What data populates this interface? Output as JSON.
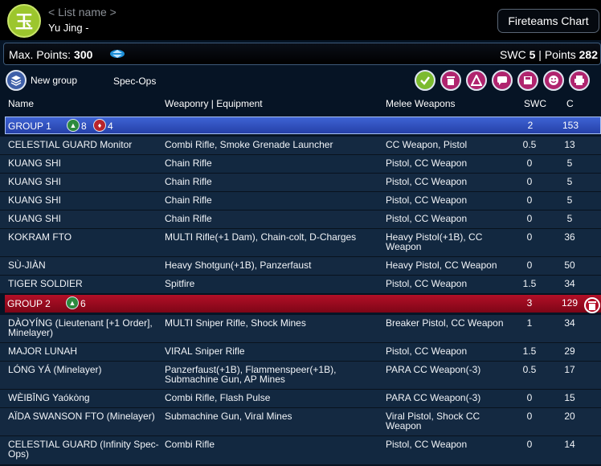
{
  "header": {
    "faction_glyph": "玉",
    "list_name": "< List name >",
    "sectorial": "Yu Jing -",
    "fireteams_button": "Fireteams Chart"
  },
  "points": {
    "max_label": "Max. Points:",
    "max_value": "300",
    "swc_label": "SWC",
    "swc_value": "5",
    "separator": "|",
    "points_label": "Points",
    "points_value": "282"
  },
  "toolbar": {
    "new_group": "New group",
    "specops": "Spec-Ops",
    "icons": [
      "validate-icon",
      "trash-icon",
      "army-logo-icon",
      "chat-icon",
      "save-icon",
      "smiley-icon",
      "print-icon"
    ]
  },
  "columns": {
    "name": "Name",
    "weapons": "Weaponry | Equipment",
    "melee": "Melee Weapons",
    "swc": "SWC",
    "c": "C"
  },
  "groups": [
    {
      "label": "GROUP 1",
      "regular": "8",
      "irregular": "4",
      "swc": "2",
      "c": "153"
    },
    {
      "label": "GROUP 2",
      "regular": "6",
      "swc": "3",
      "c": "129"
    }
  ],
  "group1_units": [
    {
      "name": "CELESTIAL GUARD Monitor",
      "weapons": "Combi Rifle, Smoke Grenade Launcher",
      "melee": "CC Weapon, Pistol",
      "swc": "0.5",
      "c": "13"
    },
    {
      "name": "KUANG SHI",
      "weapons": "Chain Rifle",
      "melee": "Pistol, CC Weapon",
      "swc": "0",
      "c": "5"
    },
    {
      "name": "KUANG SHI",
      "weapons": "Chain Rifle",
      "melee": "Pistol, CC Weapon",
      "swc": "0",
      "c": "5"
    },
    {
      "name": "KUANG SHI",
      "weapons": "Chain Rifle",
      "melee": "Pistol, CC Weapon",
      "swc": "0",
      "c": "5"
    },
    {
      "name": "KUANG SHI",
      "weapons": "Chain Rifle",
      "melee": "Pistol, CC Weapon",
      "swc": "0",
      "c": "5"
    },
    {
      "name": "KOKRAM FTO",
      "weapons": "MULTI Rifle(+1 Dam), Chain-colt, D-Charges",
      "melee": "Heavy Pistol(+1B), CC Weapon",
      "swc": "0",
      "c": "36"
    },
    {
      "name": "SÙ-JIÀN",
      "weapons": "Heavy Shotgun(+1B), Panzerfaust",
      "melee": "Heavy Pistol, CC Weapon",
      "swc": "0",
      "c": "50"
    },
    {
      "name": "TIGER SOLDIER",
      "weapons": "Spitfire",
      "melee": "Pistol, CC Weapon",
      "swc": "1.5",
      "c": "34"
    }
  ],
  "group2_units": [
    {
      "name": "DÀOYÍNG (Lieutenant [+1 Order], Minelayer)",
      "weapons": "MULTI Sniper Rifle, Shock Mines",
      "melee": "Breaker Pistol, CC Weapon",
      "swc": "1",
      "c": "34"
    },
    {
      "name": "MAJOR LUNAH",
      "weapons": "VIRAL Sniper Rifle",
      "melee": "Pistol, CC Weapon",
      "swc": "1.5",
      "c": "29"
    },
    {
      "name": "LÓNG YÁ (Minelayer)",
      "weapons": "Panzerfaust(+1B), Flammenspeer(+1B), Submachine Gun, AP Mines",
      "melee": "PARA CC Weapon(-3)",
      "swc": "0.5",
      "c": "17"
    },
    {
      "name": "WÈIBĪNG Yaókòng",
      "weapons": "Combi Rifle, Flash Pulse",
      "melee": "PARA CC Weapon(-3)",
      "swc": "0",
      "c": "15"
    },
    {
      "name": "AÏDA SWANSON FTO (Minelayer)",
      "weapons": "Submachine Gun, Viral Mines",
      "melee": "Viral Pistol, Shock CC Weapon",
      "swc": "0",
      "c": "20"
    },
    {
      "name": "CELESTIAL GUARD (Infinity Spec-Ops)",
      "weapons": "Combi Rifle",
      "melee": "Pistol, CC Weapon",
      "swc": "0",
      "c": "14"
    }
  ],
  "colors": {
    "group1": "#2f4fc4",
    "group2": "#a10c22",
    "accent_green": "#9cc62d"
  }
}
